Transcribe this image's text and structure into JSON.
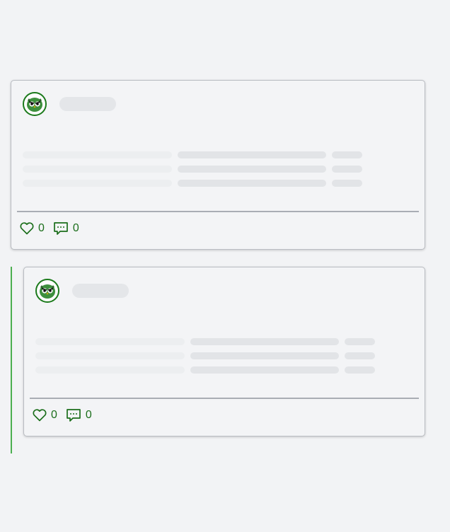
{
  "posts": [
    {
      "likes": "0",
      "comments": "0"
    },
    {
      "likes": "0",
      "comments": "0"
    }
  ],
  "colors": {
    "accent": "#1b6e1b",
    "thread_line": "#4caf50",
    "skeleton": "#e4e6e9",
    "background": "#f2f3f5"
  },
  "icons": {
    "avatar": "owl-icon",
    "like": "heart-icon",
    "comment": "comment-icon"
  }
}
